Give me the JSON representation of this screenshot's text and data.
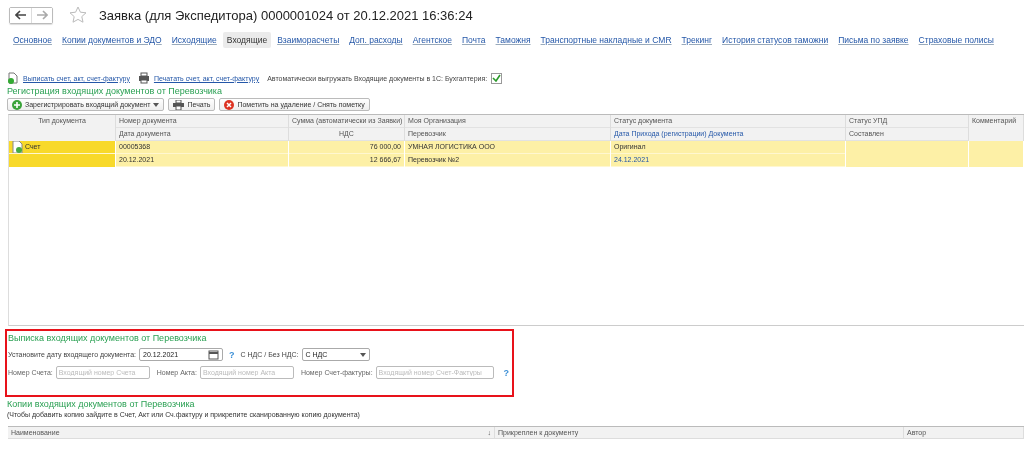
{
  "window": {
    "title": "Заявка (для Экспедитора) 0000001024 от 20.12.2021 16:36:24",
    "favorite": false
  },
  "tabs": [
    {
      "label": "Основное",
      "selected": false
    },
    {
      "label": "Копии документов и ЭДО",
      "selected": false
    },
    {
      "label": "Исходящие",
      "selected": false
    },
    {
      "label": "Входящие",
      "selected": true
    },
    {
      "label": "Взаиморасчеты",
      "selected": false
    },
    {
      "label": "Доп. расходы",
      "selected": false
    },
    {
      "label": "Агентское",
      "selected": false
    },
    {
      "label": "Почта",
      "selected": false
    },
    {
      "label": "Таможня",
      "selected": false
    },
    {
      "label": "Транспортные накладные и CMR",
      "selected": false
    },
    {
      "label": "Трекинг",
      "selected": false
    },
    {
      "label": "История статусов таможни",
      "selected": false
    },
    {
      "label": "Письма по заявке",
      "selected": false
    },
    {
      "label": "Страховые полисы",
      "selected": false
    }
  ],
  "actions": {
    "issue_link": "Выписать счет, акт, счет-фактуру",
    "print_link": "Печатать счет, акт, счет-фактуру",
    "auto_export": {
      "label": "Автоматически выгружать Входящие документы в 1С: Бухгалтерия:",
      "checked": true
    }
  },
  "registration": {
    "title": "Регистрация входящих документов от Перевозчика",
    "buttons": [
      {
        "kind": "add",
        "label": "Зарегистрировать входящий документ"
      },
      {
        "kind": "print",
        "label": "Печать"
      },
      {
        "kind": "delete",
        "label": "Пометить на удаление / Снять пометку"
      }
    ],
    "columns": [
      {
        "lines": [
          {
            "text": "Тип документа",
            "link": false
          }
        ]
      },
      {
        "lines": [
          {
            "text": "Номер документа",
            "link": false
          },
          {
            "text": "Дата документа",
            "link": false
          }
        ]
      },
      {
        "lines": [
          {
            "text": "Сумма (автоматически из Заявки)",
            "link": false
          },
          {
            "text": "НДС",
            "link": false
          }
        ]
      },
      {
        "lines": [
          {
            "text": "Моя Организация",
            "link": false
          },
          {
            "text": "Перевозчик",
            "link": false
          }
        ]
      },
      {
        "lines": [
          {
            "text": "Статус документа",
            "link": false
          },
          {
            "text": "Дата Прихода (регистрации) Документа",
            "link": true
          }
        ]
      },
      {
        "lines": [
          {
            "text": "Статус УПД",
            "link": false
          },
          {
            "text": "Составлен",
            "link": false
          }
        ]
      },
      {
        "lines": [
          {
            "text": "Комментарий",
            "link": false
          }
        ]
      }
    ],
    "rows": [
      {
        "selected": true,
        "cells": [
          {
            "lines": [
              {
                "text": "Счет",
                "link": false
              }
            ]
          },
          {
            "lines": [
              {
                "text": "00005368",
                "link": false
              },
              {
                "text": "20.12.2021",
                "link": false
              }
            ]
          },
          {
            "lines": [
              {
                "text": "76 000,00",
                "link": false
              },
              {
                "text": "12 666,67",
                "link": false
              }
            ]
          },
          {
            "lines": [
              {
                "text": "УМНАЯ ЛОГИСТИКА ООО",
                "link": false
              },
              {
                "text": "Перевозчик №2",
                "link": false
              }
            ]
          },
          {
            "lines": [
              {
                "text": "Оригинал",
                "link": false
              },
              {
                "text": "24.12.2021",
                "link": true
              }
            ]
          },
          {},
          {}
        ]
      }
    ]
  },
  "issue": {
    "title": "Выписка входящих документов от Перевозчика",
    "highlighted": true,
    "date_label": "Установите дату входящего документа:",
    "date_value": "20.12.2021",
    "help": "?",
    "vat_label": "С НДС / Без НДС:",
    "vat_value": "С НДС",
    "fields": [
      {
        "label": "Номер Счета:",
        "placeholder": "Входящий номер Счета"
      },
      {
        "label": "Номер Акта:",
        "placeholder": "Входящий номер Акта"
      },
      {
        "label": "Номер Счет-фактуры:",
        "placeholder": "Входящий номер Счет-Фактуры"
      }
    ],
    "fields_help": "?"
  },
  "copies": {
    "title": "Копии входящих документов от Перевозчика",
    "note": "(Чтобы добавить копию зайдите в Счет, Акт или Сч.фактуру и прикрепите сканированную копию документа)",
    "columns": [
      {
        "label": "Наименование",
        "sort": "↓"
      },
      {
        "label": "Прикреплен к документу"
      },
      {
        "label": "Автор"
      }
    ]
  }
}
